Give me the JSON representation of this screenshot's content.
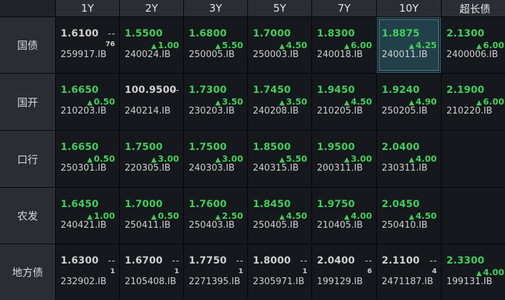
{
  "columns": [
    "1Y",
    "2Y",
    "3Y",
    "5Y",
    "7Y",
    "10Y",
    "超长债"
  ],
  "rows": [
    {
      "label": "国债",
      "cells": [
        {
          "yield": "1.6100",
          "dash": "--",
          "count": "76",
          "code": "259917.IB"
        },
        {
          "yield": "1.5500",
          "change": "1.00",
          "code": "240024.IB"
        },
        {
          "yield": "1.6800",
          "change": "5.50",
          "code": "250005.IB"
        },
        {
          "yield": "1.7000",
          "change": "4.50",
          "code": "250003.IB"
        },
        {
          "yield": "1.8300",
          "change": "6.00",
          "code": "240018.IB"
        },
        {
          "yield": "1.8875",
          "change": "4.25",
          "code": "240011.IB",
          "highlight": true
        },
        {
          "yield": "2.1300",
          "change": "6.00",
          "code": "2400006.IB"
        }
      ]
    },
    {
      "label": "国开",
      "cells": [
        {
          "yield": "1.6650",
          "change": "0.50",
          "code": "210203.IB"
        },
        {
          "yield": "100.9500",
          "dash": "--",
          "code": "240214.IB"
        },
        {
          "yield": "1.7300",
          "change": "3.50",
          "code": "230203.IB"
        },
        {
          "yield": "1.7450",
          "change": "3.50",
          "code": "240208.IB"
        },
        {
          "yield": "1.9450",
          "change": "4.50",
          "code": "210205.IB"
        },
        {
          "yield": "1.9240",
          "change": "4.90",
          "code": "250205.IB"
        },
        {
          "yield": "2.1900",
          "change": "6.00",
          "code": "210220.IB"
        }
      ]
    },
    {
      "label": "口行",
      "cells": [
        {
          "yield": "1.6650",
          "change": "0.50",
          "code": "250301.IB"
        },
        {
          "yield": "1.7500",
          "change": "3.00",
          "code": "220305.IB"
        },
        {
          "yield": "1.7500",
          "change": "3.00",
          "code": "240303.IB"
        },
        {
          "yield": "1.8500",
          "change": "5.50",
          "code": "240315.IB"
        },
        {
          "yield": "1.9500",
          "change": "3.00",
          "code": "200311.IB"
        },
        {
          "yield": "2.0400",
          "change": "4.00",
          "code": "230311.IB"
        },
        {}
      ]
    },
    {
      "label": "农发",
      "cells": [
        {
          "yield": "1.6450",
          "change": "1.00",
          "code": "240421.IB"
        },
        {
          "yield": "1.7000",
          "change": "0.50",
          "code": "250411.IB"
        },
        {
          "yield": "1.7600",
          "change": "2.50",
          "code": "250403.IB"
        },
        {
          "yield": "1.8450",
          "change": "4.50",
          "code": "250405.IB"
        },
        {
          "yield": "1.9750",
          "change": "4.00",
          "code": "210405.IB"
        },
        {
          "yield": "2.0450",
          "change": "4.50",
          "code": "250410.IB"
        },
        {}
      ]
    },
    {
      "label": "地方债",
      "cells": [
        {
          "yield": "1.6300",
          "dash": "--",
          "count": "1",
          "code": "232902.IB"
        },
        {
          "yield": "1.6700",
          "dash": "--",
          "count": "1",
          "code": "2105408.IB"
        },
        {
          "yield": "1.7750",
          "dash": "--",
          "count": "1",
          "code": "2271395.IB"
        },
        {
          "yield": "1.8000",
          "dash": "--",
          "count": "1",
          "code": "2305971.IB"
        },
        {
          "yield": "2.0400",
          "dash": "--",
          "count": "6",
          "code": "199129.IB"
        },
        {
          "yield": "2.1100",
          "dash": "--",
          "count": "4",
          "code": "2471187.IB"
        },
        {
          "yield": "2.3300",
          "change": "4.00",
          "code": "199131.IB"
        }
      ]
    }
  ],
  "icons": {
    "up_arrow": "▲"
  },
  "colors": {
    "up": "#3fcf5a",
    "flat": "#d0d0d0",
    "highlight": "#22404a"
  }
}
